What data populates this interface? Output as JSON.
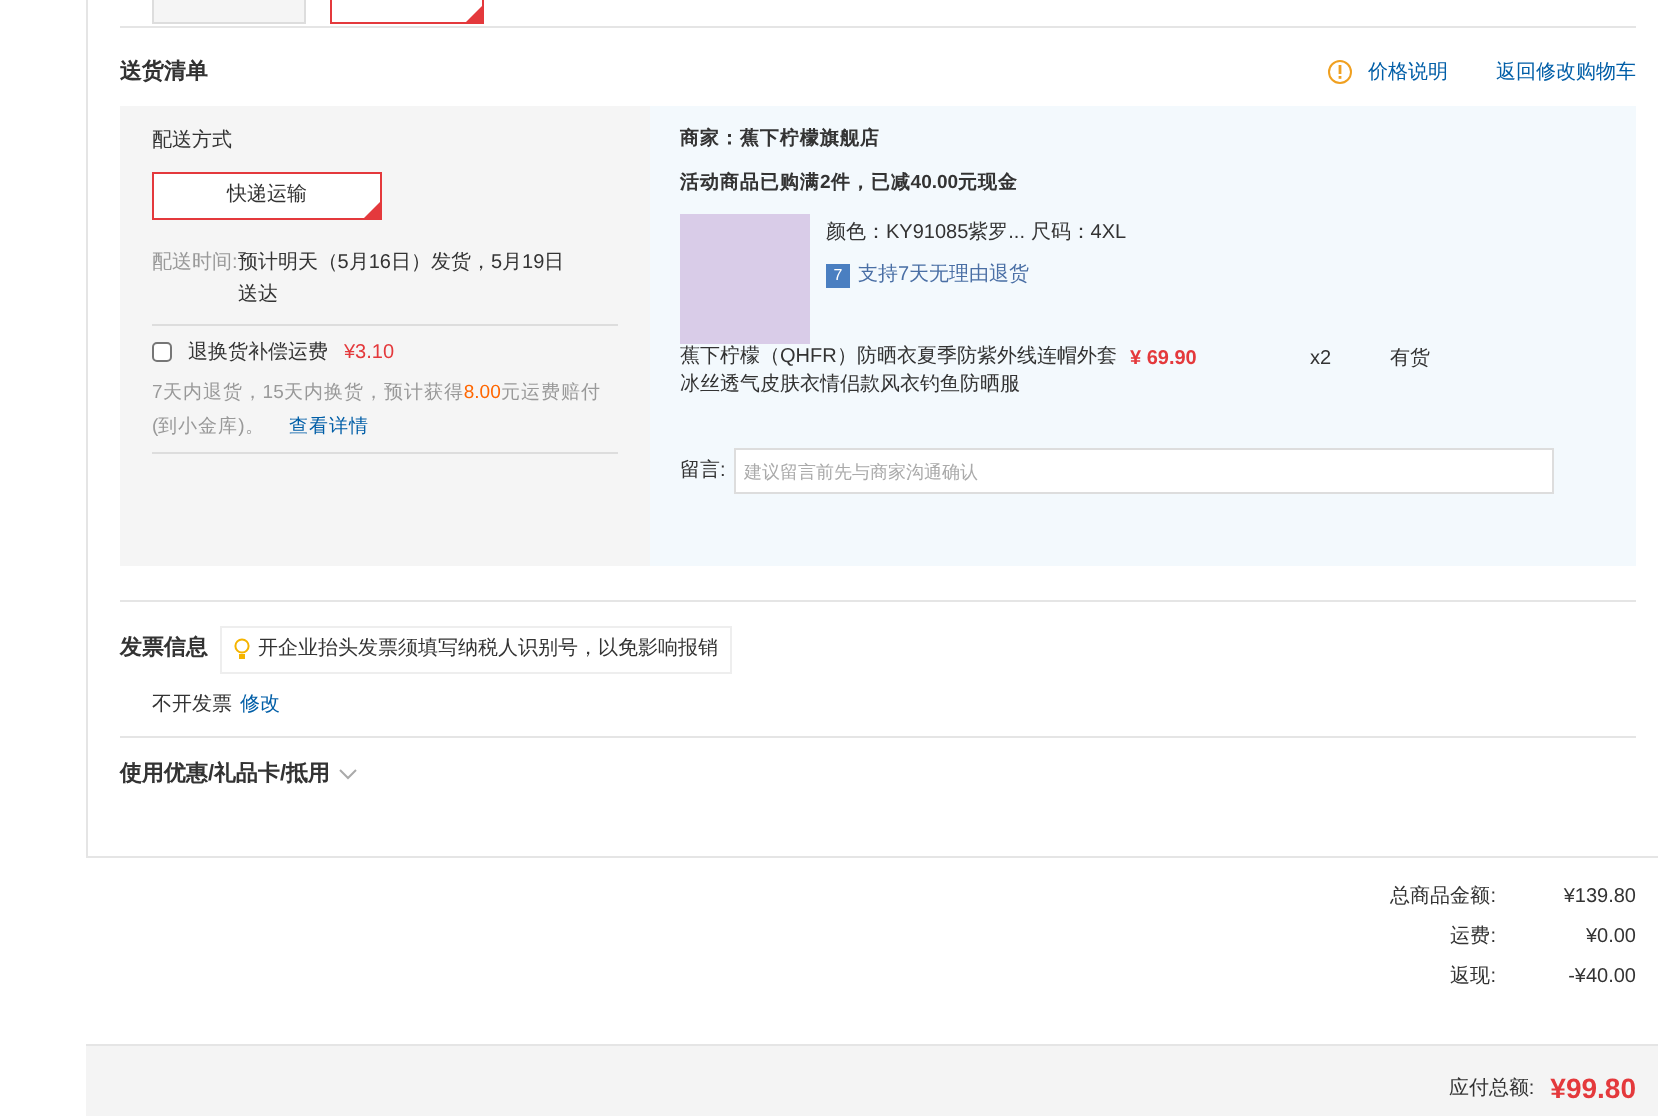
{
  "payment_buttons": [
    {
      "selected": false
    },
    {
      "selected": true
    }
  ],
  "section_title": "送货清单",
  "header_links": [
    {
      "label": "价格说明",
      "kind": "info"
    },
    {
      "label": "返回修改购物车",
      "kind": "plain"
    }
  ],
  "delivery": {
    "title": "配送方式",
    "method": "快递运输",
    "method_selected": true,
    "time_label": "配送时间:",
    "time_value": "预计明天（5月16日）发货，5月19日送达",
    "insurance": {
      "label": "退换货补偿运费",
      "price": "¥3.10",
      "checked": false
    },
    "note": "7天内退货，15天内换货，预计获得**8.00**元运费赔付(到小金库)。",
    "note_link": "查看详情"
  },
  "shop": {
    "merchant": "商家：蕉下柠檬旗舰店",
    "promo": "活动商品已购满2件，已减40.00元现金",
    "item": {
      "attrs": "颜色：KY91085紫罗... 尺码：4XL",
      "badge": "7",
      "return_policy": "支持7天无理由退货",
      "name": "蕉下柠檬（QHFR）防晒衣夏季防紫外线连帽外套冰丝透气皮肤衣情侣款风衣钓鱼防晒服",
      "price": "¥ 69.90",
      "qty": "x2",
      "stock": "有货"
    },
    "message_label": "留言:",
    "message_placeholder": "建议留言前先与商家沟通确认"
  },
  "invoice": {
    "title": "发票信息",
    "tip": "开企业抬头发票须填写纳税人识别号，以免影响报销",
    "value": "不开发票",
    "edit_link": "修改"
  },
  "coupon": {
    "title": "使用优惠/礼品卡/抵用",
    "expanded": false
  },
  "summary": [
    {
      "label": "总商品金额:",
      "value": "¥139.80"
    },
    {
      "label": "运费:",
      "value": "¥0.00"
    },
    {
      "label": "返现:",
      "value": "-¥40.00"
    }
  ],
  "total": {
    "label": "应付总额:",
    "value": "¥99.80"
  }
}
